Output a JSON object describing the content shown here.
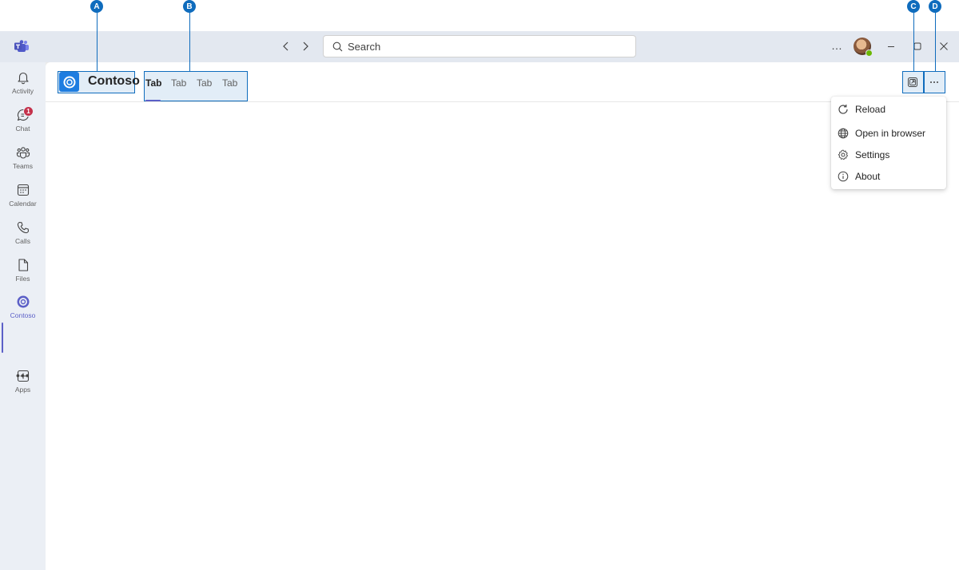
{
  "callouts": [
    "A",
    "B",
    "C",
    "D"
  ],
  "titlebar": {
    "search_placeholder": "Search",
    "more_label": "…"
  },
  "appbar": {
    "items": [
      {
        "label": "Activity",
        "icon": "bell-icon"
      },
      {
        "label": "Chat",
        "icon": "chat-icon",
        "badge": "1"
      },
      {
        "label": "Teams",
        "icon": "teams-icon"
      },
      {
        "label": "Calendar",
        "icon": "calendar-icon"
      },
      {
        "label": "Calls",
        "icon": "phone-icon"
      },
      {
        "label": "Files",
        "icon": "file-icon"
      },
      {
        "label": "Contoso",
        "icon": "contoso-icon",
        "active": true
      },
      {
        "label": "Apps",
        "icon": "add-app-icon"
      }
    ],
    "more_label": "•••"
  },
  "app": {
    "name": "Contoso",
    "tabs": [
      "Tab",
      "Tab",
      "Tab",
      "Tab"
    ],
    "active_tab": 0
  },
  "menu": {
    "items": [
      "Reload",
      "Open in browser",
      "Settings",
      "About"
    ]
  },
  "colors": {
    "accent": "#5b5fc7",
    "callout": "#0f6cbd",
    "badge": "#c4314b",
    "presence": "#6bb700"
  }
}
